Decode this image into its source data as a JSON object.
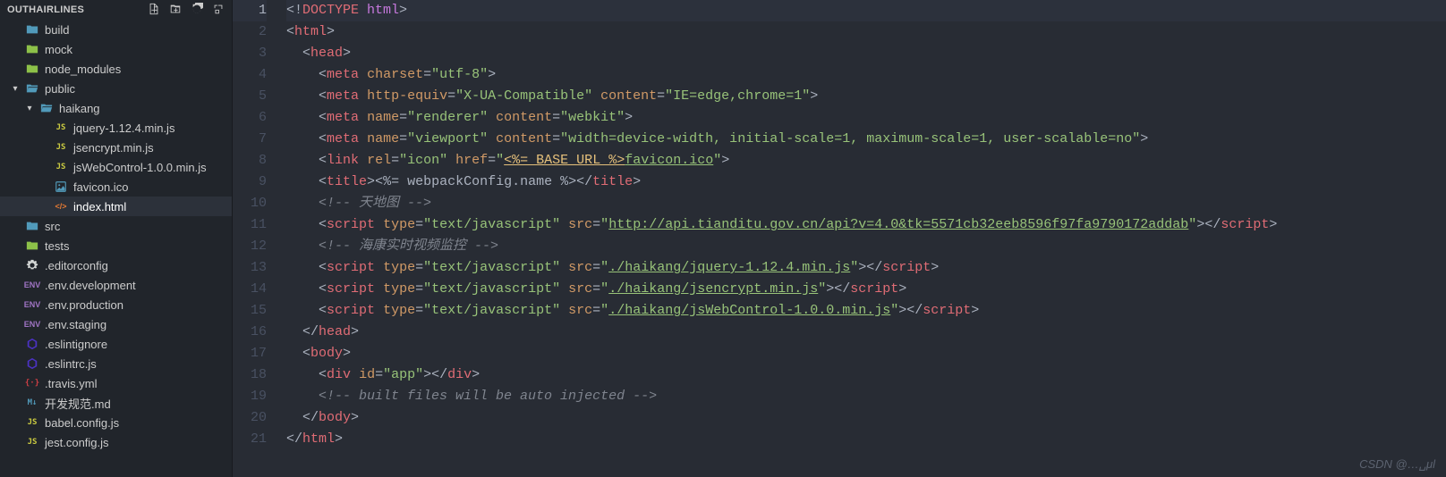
{
  "sidebar": {
    "title": "OUTHAIRLINES",
    "items": [
      {
        "label": "build",
        "icon": "folder",
        "depth": 0
      },
      {
        "label": "mock",
        "icon": "folder-green",
        "depth": 0
      },
      {
        "label": "node_modules",
        "icon": "folder-green",
        "depth": 0
      },
      {
        "label": "public",
        "icon": "folder-open",
        "depth": 0,
        "chevron": "down"
      },
      {
        "label": "haikang",
        "icon": "folder-open",
        "depth": 1,
        "chevron": "down"
      },
      {
        "label": "jquery-1.12.4.min.js",
        "icon": "js",
        "depth": 2
      },
      {
        "label": "jsencrypt.min.js",
        "icon": "js",
        "depth": 2
      },
      {
        "label": "jsWebControl-1.0.0.min.js",
        "icon": "js",
        "depth": 2
      },
      {
        "label": "favicon.ico",
        "icon": "favicon",
        "depth": 2
      },
      {
        "label": "index.html",
        "icon": "html",
        "depth": 2,
        "active": true
      },
      {
        "label": "src",
        "icon": "folder",
        "depth": 0
      },
      {
        "label": "tests",
        "icon": "folder-green",
        "depth": 0
      },
      {
        "label": ".editorconfig",
        "icon": "gear",
        "depth": 0
      },
      {
        "label": ".env.development",
        "icon": "env",
        "depth": 0
      },
      {
        "label": ".env.production",
        "icon": "env",
        "depth": 0
      },
      {
        "label": ".env.staging",
        "icon": "env",
        "depth": 0
      },
      {
        "label": ".eslintignore",
        "icon": "eslint",
        "depth": 0
      },
      {
        "label": ".eslintrc.js",
        "icon": "eslint",
        "depth": 0
      },
      {
        "label": ".travis.yml",
        "icon": "redcurly",
        "depth": 0
      },
      {
        "label": "开发规范.md",
        "icon": "md",
        "depth": 0
      },
      {
        "label": "babel.config.js",
        "icon": "js",
        "depth": 0
      },
      {
        "label": "jest.config.js",
        "icon": "js",
        "depth": 0
      }
    ]
  },
  "editor": {
    "highlight_line": 1,
    "lines": [
      {
        "n": 1,
        "tokens": [
          [
            "bracket",
            "<!"
          ],
          [
            "doctype",
            "DOCTYPE "
          ],
          [
            "doctype-kw",
            "html"
          ],
          [
            "bracket",
            ">"
          ]
        ]
      },
      {
        "n": 2,
        "tokens": [
          [
            "bracket",
            "<"
          ],
          [
            "tag",
            "html"
          ],
          [
            "bracket",
            ">"
          ]
        ]
      },
      {
        "n": 3,
        "tokens": [
          [
            "plain",
            "  "
          ],
          [
            "bracket",
            "<"
          ],
          [
            "tag",
            "head"
          ],
          [
            "bracket",
            ">"
          ]
        ]
      },
      {
        "n": 4,
        "tokens": [
          [
            "plain",
            "    "
          ],
          [
            "bracket",
            "<"
          ],
          [
            "tag",
            "meta"
          ],
          [
            "plain",
            " "
          ],
          [
            "attr",
            "charset"
          ],
          [
            "op",
            "="
          ],
          [
            "str",
            "\"utf-8\""
          ],
          [
            "bracket",
            ">"
          ]
        ]
      },
      {
        "n": 5,
        "tokens": [
          [
            "plain",
            "    "
          ],
          [
            "bracket",
            "<"
          ],
          [
            "tag",
            "meta"
          ],
          [
            "plain",
            " "
          ],
          [
            "attr",
            "http-equiv"
          ],
          [
            "op",
            "="
          ],
          [
            "str",
            "\"X-UA-Compatible\""
          ],
          [
            "plain",
            " "
          ],
          [
            "attr",
            "content"
          ],
          [
            "op",
            "="
          ],
          [
            "str",
            "\"IE=edge,chrome=1\""
          ],
          [
            "bracket",
            ">"
          ]
        ]
      },
      {
        "n": 6,
        "tokens": [
          [
            "plain",
            "    "
          ],
          [
            "bracket",
            "<"
          ],
          [
            "tag",
            "meta"
          ],
          [
            "plain",
            " "
          ],
          [
            "attr",
            "name"
          ],
          [
            "op",
            "="
          ],
          [
            "str",
            "\"renderer\""
          ],
          [
            "plain",
            " "
          ],
          [
            "attr",
            "content"
          ],
          [
            "op",
            "="
          ],
          [
            "str",
            "\"webkit\""
          ],
          [
            "bracket",
            ">"
          ]
        ]
      },
      {
        "n": 7,
        "tokens": [
          [
            "plain",
            "    "
          ],
          [
            "bracket",
            "<"
          ],
          [
            "tag",
            "meta"
          ],
          [
            "plain",
            " "
          ],
          [
            "attr",
            "name"
          ],
          [
            "op",
            "="
          ],
          [
            "str",
            "\"viewport\""
          ],
          [
            "plain",
            " "
          ],
          [
            "attr",
            "content"
          ],
          [
            "op",
            "="
          ],
          [
            "str",
            "\"width=device-width, initial-scale=1, maximum-scale=1, user-scalable=no\""
          ],
          [
            "bracket",
            ">"
          ]
        ]
      },
      {
        "n": 8,
        "tokens": [
          [
            "plain",
            "    "
          ],
          [
            "bracket",
            "<"
          ],
          [
            "tag",
            "link"
          ],
          [
            "plain",
            " "
          ],
          [
            "attr",
            "rel"
          ],
          [
            "op",
            "="
          ],
          [
            "str",
            "\"icon\""
          ],
          [
            "plain",
            " "
          ],
          [
            "attr",
            "href"
          ],
          [
            "op",
            "="
          ],
          [
            "str",
            "\""
          ],
          [
            "embed",
            "<%= BASE_URL %>"
          ],
          [
            "link",
            "favicon.ico"
          ],
          [
            "str",
            "\""
          ],
          [
            "bracket",
            ">"
          ]
        ]
      },
      {
        "n": 9,
        "tokens": [
          [
            "plain",
            "    "
          ],
          [
            "bracket",
            "<"
          ],
          [
            "tag",
            "title"
          ],
          [
            "bracket",
            ">"
          ],
          [
            "plain",
            "<%= webpackConfig.name %>"
          ],
          [
            "bracket",
            "</"
          ],
          [
            "tag",
            "title"
          ],
          [
            "bracket",
            ">"
          ]
        ]
      },
      {
        "n": 10,
        "tokens": [
          [
            "plain",
            "    "
          ],
          [
            "comment",
            "<!-- 天地图 -->"
          ]
        ]
      },
      {
        "n": 11,
        "tokens": [
          [
            "plain",
            "    "
          ],
          [
            "bracket",
            "<"
          ],
          [
            "tag",
            "script"
          ],
          [
            "plain",
            " "
          ],
          [
            "attr",
            "type"
          ],
          [
            "op",
            "="
          ],
          [
            "str",
            "\"text/javascript\""
          ],
          [
            "plain",
            " "
          ],
          [
            "attr",
            "src"
          ],
          [
            "op",
            "="
          ],
          [
            "str",
            "\""
          ],
          [
            "link",
            "http://api.tianditu.gov.cn/api?v=4.0&tk=5571cb32eeb8596f97fa9790172addab"
          ],
          [
            "str",
            "\""
          ],
          [
            "bracket",
            "></"
          ],
          [
            "tag",
            "script"
          ],
          [
            "bracket",
            ">"
          ]
        ]
      },
      {
        "n": 12,
        "tokens": [
          [
            "plain",
            "    "
          ],
          [
            "comment",
            "<!-- 海康实时视频监控 -->"
          ]
        ]
      },
      {
        "n": 13,
        "tokens": [
          [
            "plain",
            "    "
          ],
          [
            "bracket",
            "<"
          ],
          [
            "tag",
            "script"
          ],
          [
            "plain",
            " "
          ],
          [
            "attr",
            "type"
          ],
          [
            "op",
            "="
          ],
          [
            "str",
            "\"text/javascript\""
          ],
          [
            "plain",
            " "
          ],
          [
            "attr",
            "src"
          ],
          [
            "op",
            "="
          ],
          [
            "str",
            "\""
          ],
          [
            "link",
            "./haikang/jquery-1.12.4.min.js"
          ],
          [
            "str",
            "\""
          ],
          [
            "bracket",
            "></"
          ],
          [
            "tag",
            "script"
          ],
          [
            "bracket",
            ">"
          ]
        ]
      },
      {
        "n": 14,
        "tokens": [
          [
            "plain",
            "    "
          ],
          [
            "bracket",
            "<"
          ],
          [
            "tag",
            "script"
          ],
          [
            "plain",
            " "
          ],
          [
            "attr",
            "type"
          ],
          [
            "op",
            "="
          ],
          [
            "str",
            "\"text/javascript\""
          ],
          [
            "plain",
            " "
          ],
          [
            "attr",
            "src"
          ],
          [
            "op",
            "="
          ],
          [
            "str",
            "\""
          ],
          [
            "link",
            "./haikang/jsencrypt.min.js"
          ],
          [
            "str",
            "\""
          ],
          [
            "bracket",
            "></"
          ],
          [
            "tag",
            "script"
          ],
          [
            "bracket",
            ">"
          ]
        ]
      },
      {
        "n": 15,
        "tokens": [
          [
            "plain",
            "    "
          ],
          [
            "bracket",
            "<"
          ],
          [
            "tag",
            "script"
          ],
          [
            "plain",
            " "
          ],
          [
            "attr",
            "type"
          ],
          [
            "op",
            "="
          ],
          [
            "str",
            "\"text/javascript\""
          ],
          [
            "plain",
            " "
          ],
          [
            "attr",
            "src"
          ],
          [
            "op",
            "="
          ],
          [
            "str",
            "\""
          ],
          [
            "link",
            "./haikang/jsWebControl-1.0.0.min.js"
          ],
          [
            "str",
            "\""
          ],
          [
            "bracket",
            "></"
          ],
          [
            "tag",
            "script"
          ],
          [
            "bracket",
            ">"
          ]
        ]
      },
      {
        "n": 16,
        "tokens": [
          [
            "plain",
            "  "
          ],
          [
            "bracket",
            "</"
          ],
          [
            "tag",
            "head"
          ],
          [
            "bracket",
            ">"
          ]
        ]
      },
      {
        "n": 17,
        "tokens": [
          [
            "plain",
            "  "
          ],
          [
            "bracket",
            "<"
          ],
          [
            "tag",
            "body"
          ],
          [
            "bracket",
            ">"
          ]
        ]
      },
      {
        "n": 18,
        "tokens": [
          [
            "plain",
            "    "
          ],
          [
            "bracket",
            "<"
          ],
          [
            "tag",
            "div"
          ],
          [
            "plain",
            " "
          ],
          [
            "attr",
            "id"
          ],
          [
            "op",
            "="
          ],
          [
            "str",
            "\"app\""
          ],
          [
            "bracket",
            "></"
          ],
          [
            "tag",
            "div"
          ],
          [
            "bracket",
            ">"
          ]
        ]
      },
      {
        "n": 19,
        "tokens": [
          [
            "plain",
            "    "
          ],
          [
            "comment",
            "<!-- built files will be auto injected -->"
          ]
        ]
      },
      {
        "n": 20,
        "tokens": [
          [
            "plain",
            "  "
          ],
          [
            "bracket",
            "</"
          ],
          [
            "tag",
            "body"
          ],
          [
            "bracket",
            ">"
          ]
        ]
      },
      {
        "n": 21,
        "tokens": [
          [
            "bracket",
            "</"
          ],
          [
            "tag",
            "html"
          ],
          [
            "bracket",
            ">"
          ]
        ]
      }
    ]
  },
  "watermark": "CSDN @…␣μl"
}
